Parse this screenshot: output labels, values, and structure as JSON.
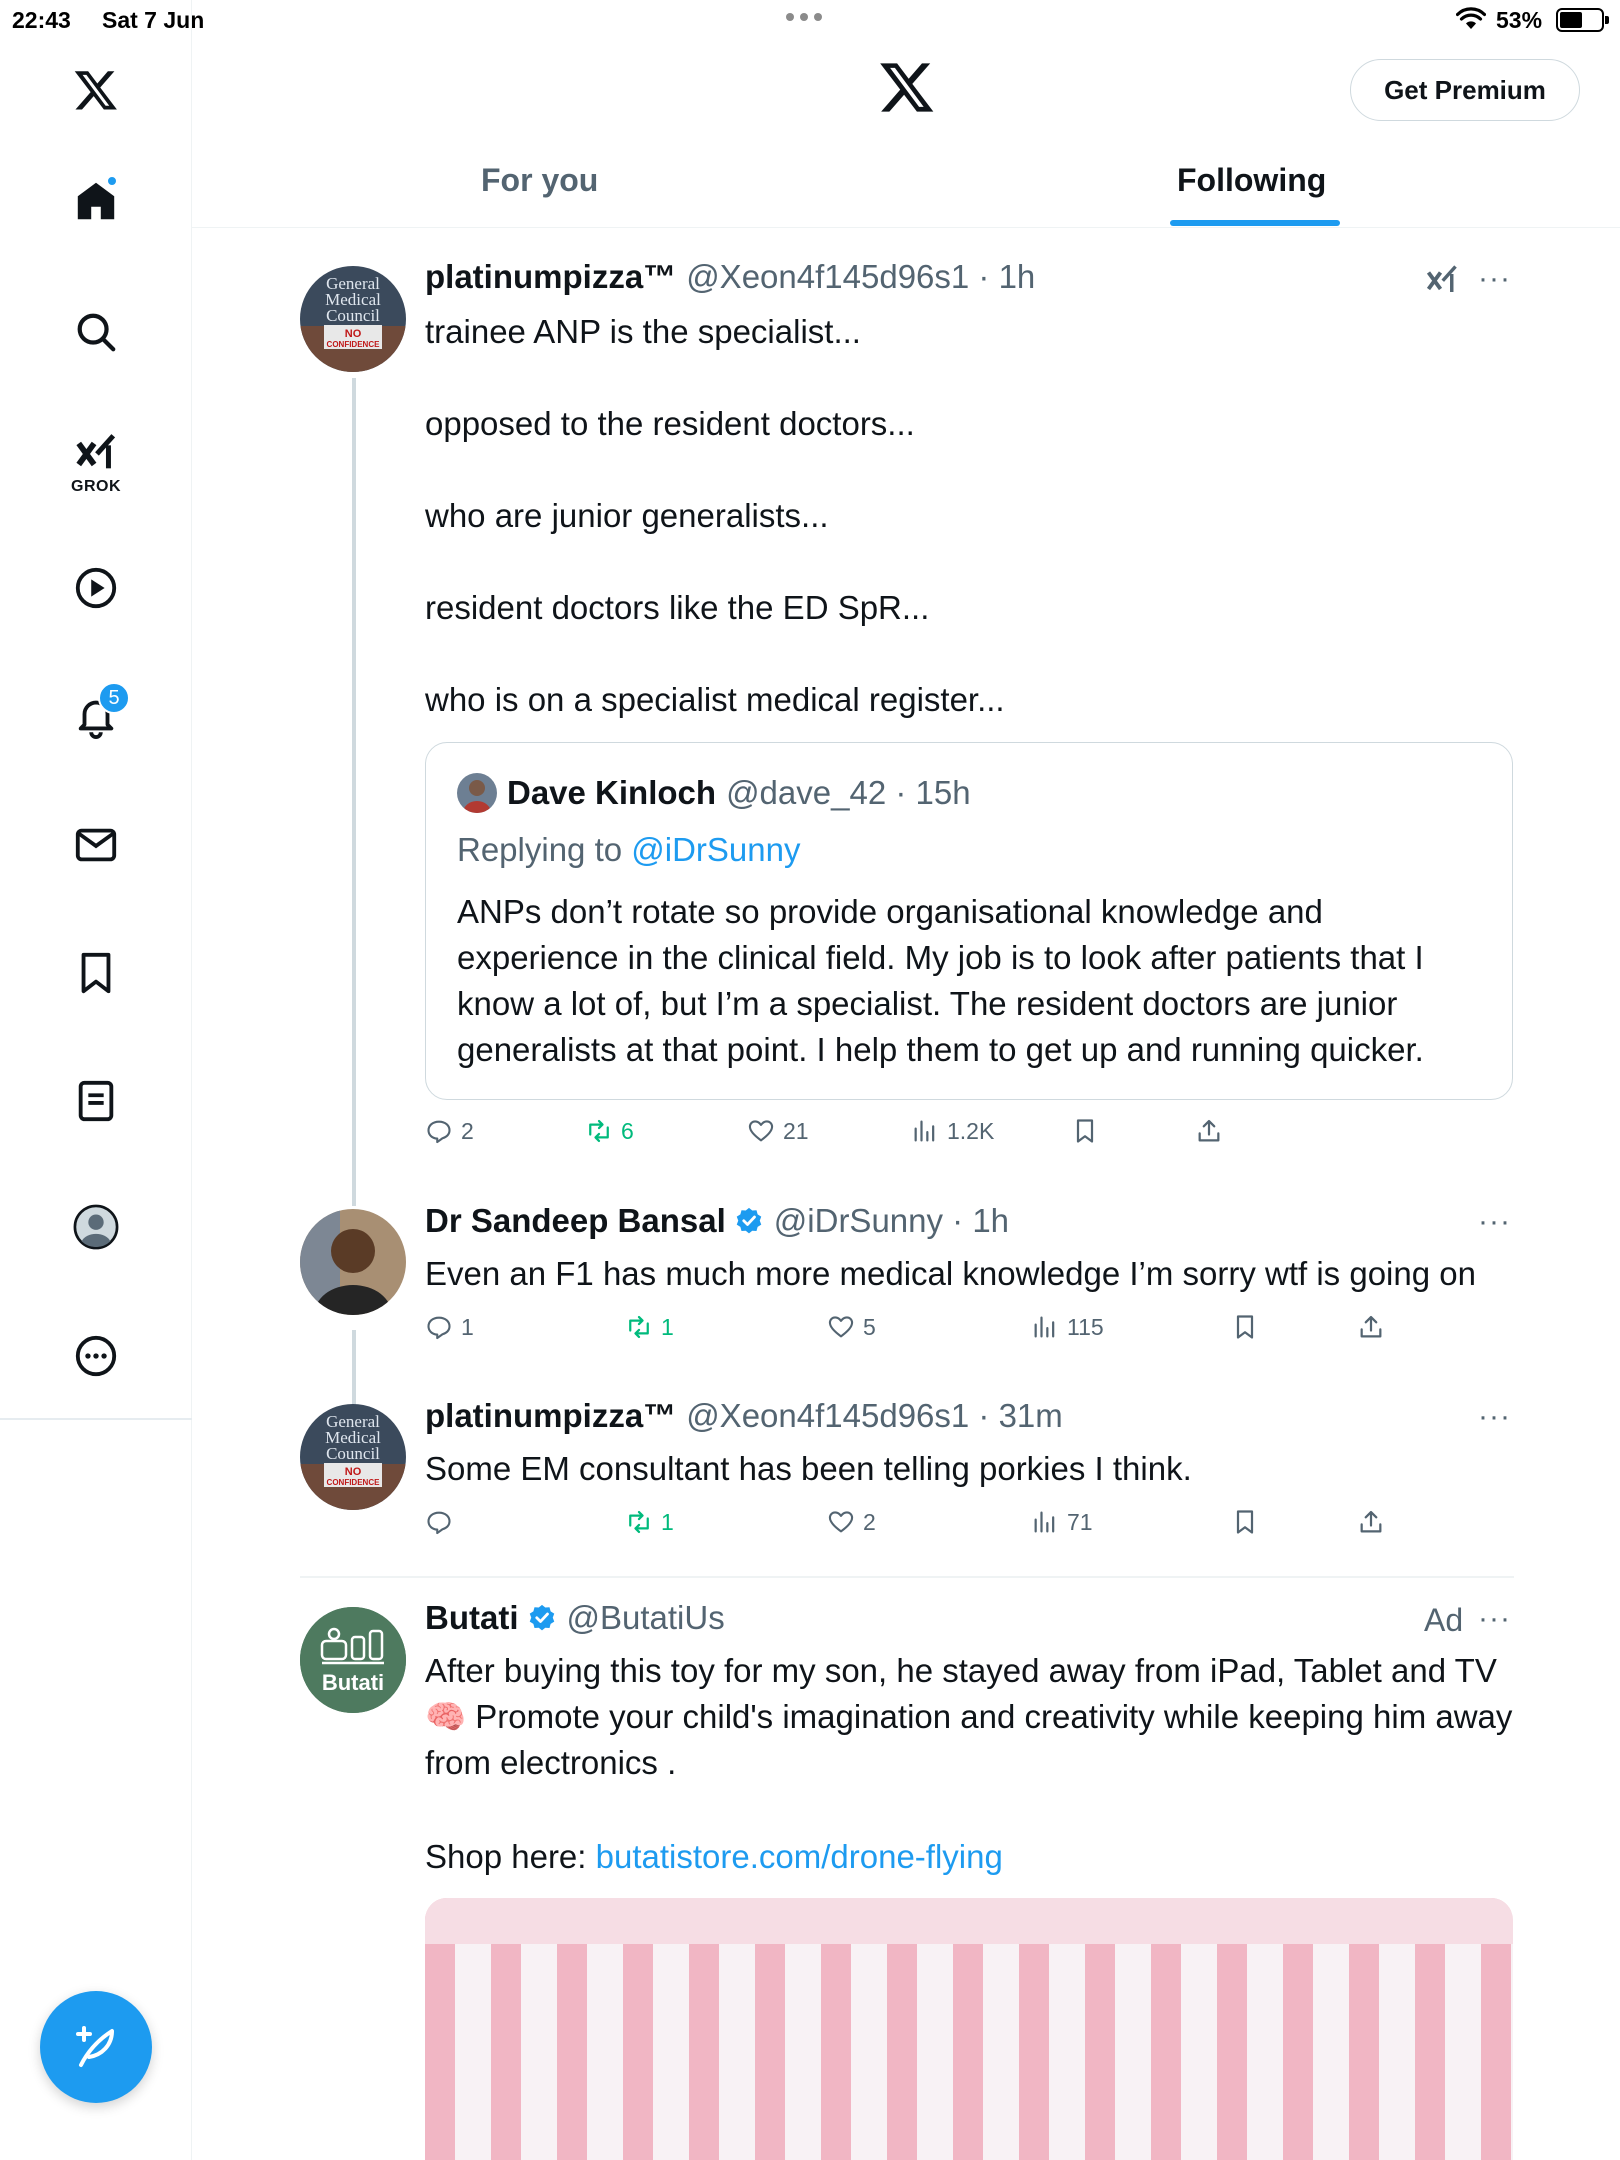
{
  "status_bar": {
    "time": "22:43",
    "date": "Sat 7 Jun",
    "battery": "53%",
    "battery_level": 0.53
  },
  "sidebar": {
    "grok_label": "GROK",
    "notifications_count": "5"
  },
  "header": {
    "premium_label": "Get Premium",
    "tabs": [
      {
        "label": "For you",
        "active": false
      },
      {
        "label": "Following",
        "active": true
      }
    ]
  },
  "tweets": [
    {
      "name": "platinumpizza™",
      "handle": "@Xeon4f145d96s1 · 1h",
      "text": "trainee ANP is the specialist...\n\nopposed to the resident doctors...\n\nwho are junior generalists...\n\nresident doctors like the ED SpR...\n\nwho is on a specialist medical register...",
      "quote": {
        "name": "Dave Kinloch",
        "handle": "@dave_42 · 15h",
        "replying_prefix": "Replying to ",
        "replying_handle": "@iDrSunny",
        "text": "ANPs don’t rotate so provide organisational knowledge and experience in the clinical field. My job is to look after patients that I know a lot of, but I’m a specialist. The resident doctors are junior generalists at that point. I help them to get up and running quicker."
      },
      "stats": {
        "replies": "2",
        "reposts": "6",
        "likes": "21",
        "views": "1.2K"
      }
    },
    {
      "name": "Dr Sandeep Bansal",
      "handle": "@iDrSunny · 1h",
      "text": "Even an F1 has much more medical knowledge I’m sorry wtf is going on",
      "stats": {
        "replies": "1",
        "reposts": "1",
        "likes": "5",
        "views": "115"
      }
    },
    {
      "name": "platinumpizza™",
      "handle": "@Xeon4f145d96s1 · 31m",
      "text": "Some EM consultant has been telling porkies I think.",
      "stats": {
        "replies": "",
        "reposts": "1",
        "likes": "2",
        "views": "71"
      }
    },
    {
      "name": "Butati",
      "handle": "@ButatiUs",
      "ad_label": "Ad",
      "avatar_text": "Butati",
      "text": "After buying this toy for my son, he stayed away from iPad, Tablet and TV 🧠 Promote your child's imagination and creativity while keeping him away from electronics .",
      "shop_prefix": "Shop here: ",
      "shop_link": "butatistore.com/drone-flying"
    }
  ],
  "avatar_texts": {
    "gmc_line1": "General",
    "gmc_line2": "Medical",
    "gmc_line3": "Council",
    "gmc_line4": "NO",
    "gmc_line5": "CONFIDENCE"
  },
  "colors": {
    "accent": "#1d9bf0",
    "repost_green": "#00ba7c",
    "secondary_text": "#536471"
  }
}
